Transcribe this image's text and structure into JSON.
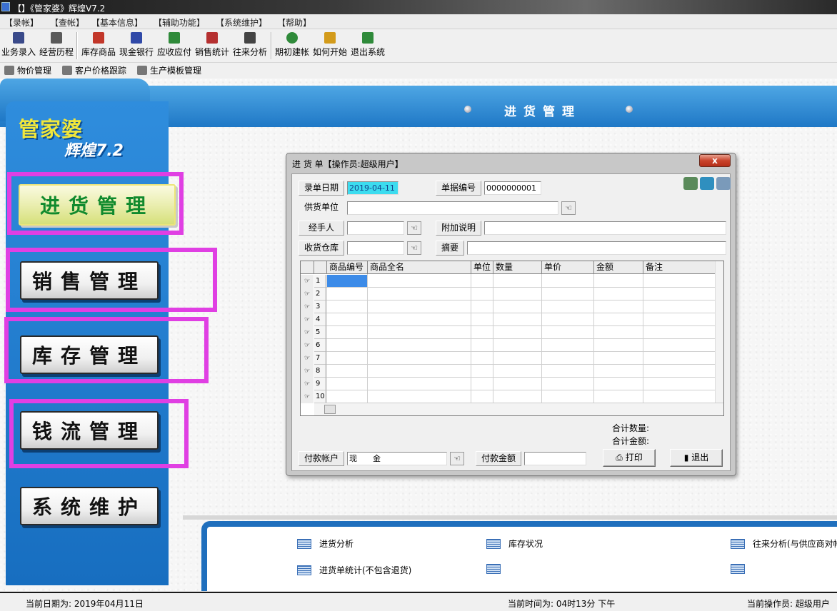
{
  "window": {
    "title": "【】《管家婆》辉煌V7.2"
  },
  "menu": [
    "【录帐】",
    "【查帐】",
    "【基本信息】",
    "【辅助功能】",
    "【系统维护】",
    "【帮助】"
  ],
  "toolbar": [
    {
      "label": "业务录入",
      "icon": "entry-icon",
      "color": "#3a4a8a"
    },
    {
      "label": "经营历程",
      "icon": "history-icon",
      "color": "#5a5a5a"
    },
    {
      "label": "库存商品",
      "icon": "stock-icon",
      "color": "#c2372a"
    },
    {
      "label": "现金银行",
      "icon": "bank-icon",
      "color": "#3049a8"
    },
    {
      "label": "应收应付",
      "icon": "receivable-icon",
      "color": "#2f8a3a"
    },
    {
      "label": "销售统计",
      "icon": "sales-stat-icon",
      "color": "#b53030"
    },
    {
      "label": "往来分析",
      "icon": "analysis-icon",
      "color": "#444444"
    },
    {
      "label": "期初建帐",
      "icon": "initial-icon",
      "color": "#2f8a3a"
    },
    {
      "label": "如何开始",
      "icon": "howto-icon",
      "color": "#d39b1b"
    },
    {
      "label": "退出系统",
      "icon": "exit-icon",
      "color": "#2f8a3a"
    }
  ],
  "subbar": [
    "物价管理",
    "客户价格跟踪",
    "生产模板管理"
  ],
  "banner": {
    "title": "进货管理"
  },
  "logo": {
    "name": "管家婆",
    "sub": "辉煌7.2"
  },
  "sidebar": [
    "进货管理",
    "销售管理",
    "库存管理",
    "钱流管理",
    "系统维护"
  ],
  "bottom_links": [
    {
      "label": "进货分析"
    },
    {
      "label": "库存状况"
    },
    {
      "label": "往来分析(与供应商对帐"
    },
    {
      "label": "进货单统计(不包含退货)"
    },
    {
      "label": ""
    },
    {
      "label": ""
    }
  ],
  "status": {
    "date": "当前日期为: 2019年04月11日",
    "time": "当前时间为: 04时13分 下午",
    "operator": "当前操作员: 超级用户"
  },
  "dialog": {
    "title": "进 货 单【操作员:超级用户】",
    "close": "x",
    "labels": {
      "entry_date": "录单日期",
      "doc_no": "单据编号",
      "supplier": "供货单位",
      "handler": "经手人",
      "extra_note": "附加说明",
      "warehouse": "收货仓库",
      "summary": "摘要",
      "pay_account": "付款帐户",
      "pay_amount": "付款金额",
      "total_qty": "合计数量:",
      "total_amount": "合计金额:"
    },
    "values": {
      "entry_date": "2019-04-11",
      "doc_no": "0000000001",
      "pay_account": "现　　金"
    },
    "columns": [
      "商品编号",
      "商品全名",
      "单位",
      "数量",
      "单价",
      "金额",
      "备注"
    ],
    "rows": [
      "1",
      "2",
      "3",
      "4",
      "5",
      "6",
      "7",
      "8",
      "9",
      "10"
    ],
    "buttons": {
      "print": "打印",
      "exit": "退出"
    }
  }
}
